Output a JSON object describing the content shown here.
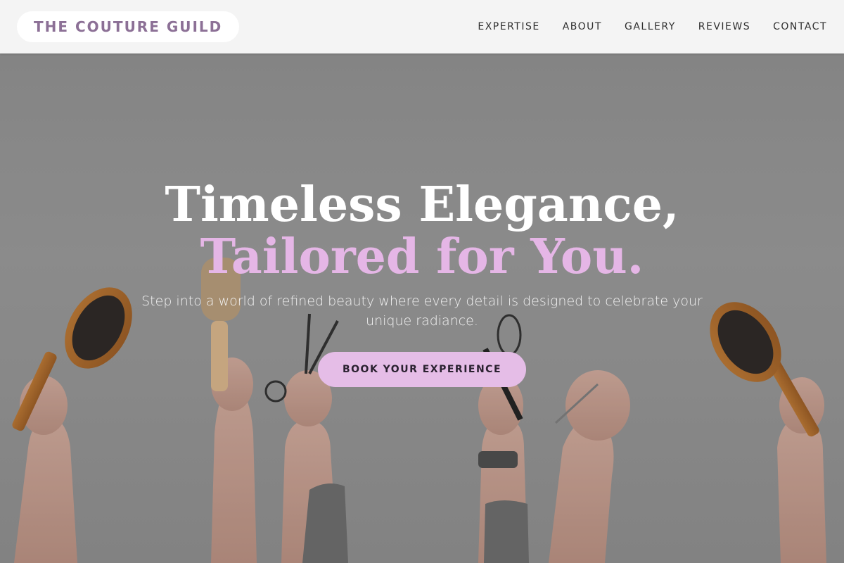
{
  "header": {
    "logo": "THE COUTURE GUILD",
    "nav": [
      {
        "label": "EXPERTISE"
      },
      {
        "label": "ABOUT"
      },
      {
        "label": "GALLERY"
      },
      {
        "label": "REVIEWS"
      },
      {
        "label": "CONTACT"
      }
    ]
  },
  "hero": {
    "headline_line1": "Timeless Elegance,",
    "headline_line2": "Tailored for You.",
    "subtext": "Step into a world of refined beauty where every detail is designed to celebrate your unique radiance.",
    "cta_label": "BOOK YOUR EXPERIENCE",
    "background_image": "hands-holding-hair-tools",
    "background_items": [
      "paddle-brush",
      "round-brush",
      "scissors",
      "tint-brush",
      "whisk",
      "comb-scissors",
      "paddle-brush"
    ]
  },
  "colors": {
    "accent": "#e5b6e6",
    "logo": "#8c7096",
    "header_bg": "#f4f4f4"
  }
}
